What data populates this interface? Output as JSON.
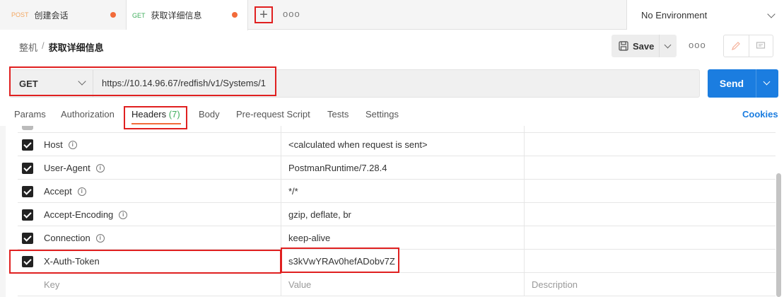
{
  "tabs": [
    {
      "method": "POST",
      "title": "创建会话"
    },
    {
      "method": "GET",
      "title": "获取详细信息"
    }
  ],
  "tab_actions": {
    "new_tab": "+",
    "more": "ooo"
  },
  "environment": {
    "selected": "No Environment"
  },
  "breadcrumb": {
    "parent": "整机",
    "separator": "/",
    "current": "获取详细信息"
  },
  "toolbar": {
    "save_label": "Save",
    "more": "ooo"
  },
  "request": {
    "method": "GET",
    "url": "https://10.14.96.67/redfish/v1/Systems/1",
    "send_label": "Send"
  },
  "request_tabs": [
    {
      "label": "Params"
    },
    {
      "label": "Authorization"
    },
    {
      "label": "Headers",
      "count": "(7)"
    },
    {
      "label": "Body"
    },
    {
      "label": "Pre-request Script"
    },
    {
      "label": "Tests"
    },
    {
      "label": "Settings"
    }
  ],
  "cookies_label": "Cookies",
  "headers_table": {
    "rows": [
      {
        "key": "Host",
        "value": "<calculated when request is sent>",
        "checked": true,
        "info": true
      },
      {
        "key": "User-Agent",
        "value": "PostmanRuntime/7.28.4",
        "checked": true,
        "info": true
      },
      {
        "key": "Accept",
        "value": "*/*",
        "checked": true,
        "info": true
      },
      {
        "key": "Accept-Encoding",
        "value": "gzip, deflate, br",
        "checked": true,
        "info": true
      },
      {
        "key": "Connection",
        "value": "keep-alive",
        "checked": true,
        "info": true
      },
      {
        "key": "X-Auth-Token",
        "value": "s3kVwYRAv0hefADobv7Z",
        "checked": true,
        "info": false
      }
    ],
    "placeholder": {
      "key": "Key",
      "value": "Value",
      "description": "Description"
    }
  },
  "colors": {
    "accent": "#f26b3a",
    "primary": "#1b7de0",
    "highlight": "#e02020",
    "get_method": "#3fae5c",
    "post_method": "#f4a862"
  }
}
